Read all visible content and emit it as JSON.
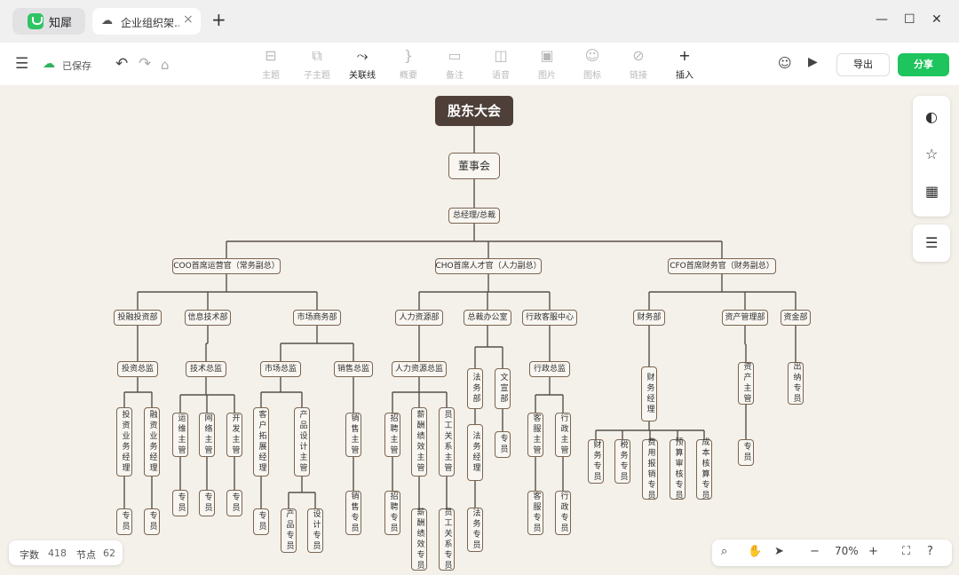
{
  "app": {
    "name": "知犀"
  },
  "tab": {
    "title": "企业组织架…",
    "close": "×"
  },
  "newtab": "+",
  "window": {
    "minimize": "—",
    "maximize": "☐",
    "close": "✕"
  },
  "header": {
    "saved": "已保存"
  },
  "tools": [
    {
      "label": "主题",
      "icon": "⊟",
      "enabled": false
    },
    {
      "label": "子主题",
      "icon": "⧉",
      "enabled": false
    },
    {
      "label": "关联线",
      "icon": "⤳",
      "enabled": true
    },
    {
      "label": "概要",
      "icon": "}",
      "enabled": false
    },
    {
      "label": "备注",
      "icon": "▭",
      "enabled": false
    },
    {
      "label": "语音",
      "icon": "◫",
      "enabled": false
    },
    {
      "label": "图片",
      "icon": "▣",
      "enabled": false
    },
    {
      "label": "图标",
      "icon": "☺",
      "enabled": false
    },
    {
      "label": "链接",
      "icon": "⊘",
      "enabled": false
    },
    {
      "label": "插入",
      "icon": "+",
      "enabled": true
    }
  ],
  "actions": {
    "export": "导出",
    "share": "分享"
  },
  "mindmap": {
    "root": "股东大会",
    "board": "董事会",
    "gm": "总经理/总裁",
    "coo": "COO首席运营官（常务副总）",
    "cho": "CHO首席人才官（人力副总）",
    "cfo": "CFO首席财务官（财务副总）",
    "d_invest": "投融投资部",
    "d_it": "信息技术部",
    "d_market": "市场商务部",
    "d_hr": "人力资源部",
    "d_office": "总裁办公室",
    "d_admin": "行政客服中心",
    "d_fin": "财务部",
    "d_asset": "资产管理部",
    "d_fund": "资金部",
    "l_invest": "投资总监",
    "l_tech": "技术总监",
    "l_mkt": "市场总监",
    "l_sales": "销售总监",
    "l_hr": "人力资源总监",
    "l_legal": "法务部",
    "l_doc": "文宣部",
    "l_admin": "行政总监",
    "l_finmgr": "财务经理",
    "l_assetmgr": "资产主管",
    "l_cashier": "出纳专员",
    "m_invest_mgr": "投资业务经理",
    "m_fin_mgr": "融资业务经理",
    "m_ops": "运维主管",
    "m_net": "网络主管",
    "m_dev": "开发主管",
    "m_client": "客户拓展经理",
    "m_product": "产品设计主管",
    "m_sales": "销售主管",
    "m_recruit": "招聘主管",
    "m_comp": "薪酬绩效主管",
    "m_relation": "员工关系主管",
    "m_legalmgr": "法务经理",
    "m_docspec": "专员",
    "m_service": "客服主管",
    "m_adminmgr": "行政主管",
    "m_finspec": "财务专员",
    "m_tax": "税务专员",
    "m_expense": "费用报销专员",
    "m_budget": "预算审核专员",
    "m_cost": "成本核算专员",
    "m_assetspec": "专员",
    "s_spec": "专员",
    "s_prodspec": "产品专员",
    "s_designspec": "设计专员",
    "s_salesspec": "销售专员",
    "s_recruitspec": "招聘专员",
    "s_compspec": "薪酬绩效专员",
    "s_relspec": "员工关系专员",
    "s_legalspec": "法务专员",
    "s_servicespec": "客服专员",
    "s_adminspec": "行政专员"
  },
  "status": {
    "words_label": "字数",
    "words": "418",
    "nodes_label": "节点",
    "nodes": "62"
  },
  "zoom": {
    "value": "70%"
  },
  "colors": {
    "accent": "#1ec45d",
    "root_bg": "#4e4039",
    "node_border": "#7a6652",
    "line": "#57504a",
    "canvas_bg": "#f4f0ea"
  }
}
